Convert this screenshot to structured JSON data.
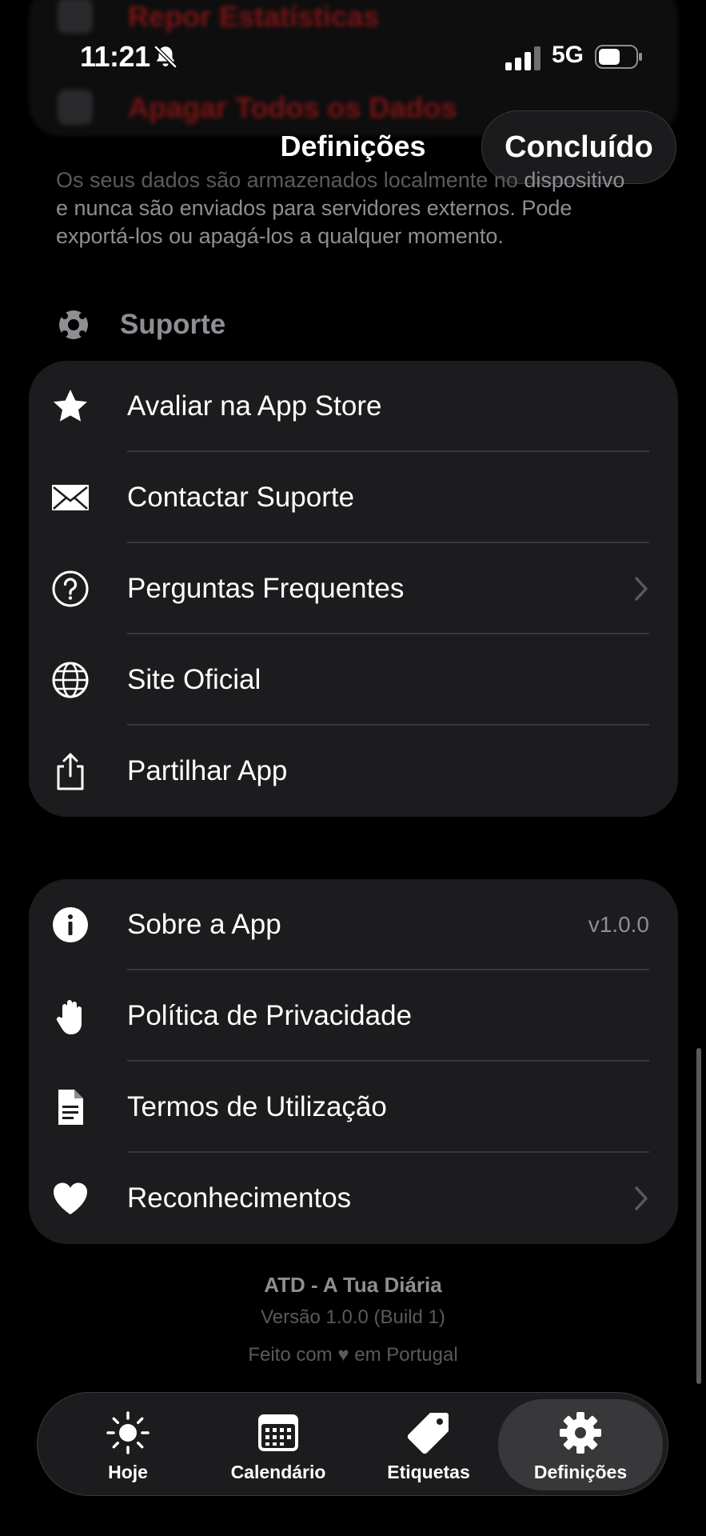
{
  "behind": {
    "row1": "Repor Estatísticas",
    "row2": "Apagar Todos os Dados"
  },
  "status_bar": {
    "time": "11:21",
    "network": "5G"
  },
  "header": {
    "title": "Definições",
    "done_label": "Concluído"
  },
  "privacy_note": {
    "faded": "Os seus dados são armazenados localmente no",
    "text": " dispositivo e nunca são enviados para servidores externos. Pode exportá-los ou apagá-los a qualquer momento."
  },
  "support": {
    "title": "Suporte",
    "items": [
      {
        "label": "Avaliar na App Store",
        "icon": "star-icon"
      },
      {
        "label": "Contactar Suporte",
        "icon": "envelope-icon"
      },
      {
        "label": "Perguntas Frequentes",
        "icon": "question-circle-icon"
      },
      {
        "label": "Site Oficial",
        "icon": "globe-icon"
      },
      {
        "label": "Partilhar App",
        "icon": "share-icon"
      }
    ]
  },
  "about": {
    "items": [
      {
        "label": "Sobre a App",
        "icon": "info-icon",
        "value": "v1.0.0"
      },
      {
        "label": "Política de Privacidade",
        "icon": "hand-icon"
      },
      {
        "label": "Termos de Utilização",
        "icon": "document-icon"
      },
      {
        "label": "Reconhecimentos",
        "icon": "heart-icon"
      }
    ]
  },
  "footer": {
    "app_name": "ATD - A Tua Diária",
    "version": "Versão 1.0.0 (Build 1)",
    "made_with": "Feito com ♥ em Portugal"
  },
  "tabs": [
    {
      "label": "Hoje",
      "icon": "sun-icon",
      "active": false
    },
    {
      "label": "Calendário",
      "icon": "calendar-icon",
      "active": false
    },
    {
      "label": "Etiquetas",
      "icon": "tag-icon",
      "active": false
    },
    {
      "label": "Definições",
      "icon": "gear-icon",
      "active": true
    }
  ],
  "colors": {
    "background": "#000000",
    "card": "#1c1c1e",
    "secondary_text": "#8e8e93",
    "separator": "#38383a"
  }
}
